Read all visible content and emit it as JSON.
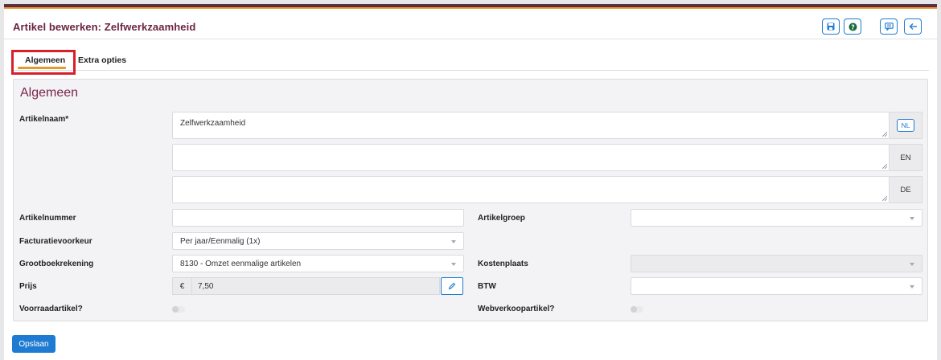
{
  "header": {
    "title": "Artikel bewerken: Zelfwerkzaamheid",
    "buttons": [
      "save-icon",
      "help-icon",
      "comment-icon",
      "back-arrow-icon"
    ]
  },
  "tabs": [
    {
      "label": "Algemeen",
      "active": true
    },
    {
      "label": "Extra opties",
      "active": false
    }
  ],
  "section": {
    "title": "Algemeen"
  },
  "form": {
    "artikelnaam": {
      "label": "Artikelnaam*",
      "translations": [
        {
          "lang": "NL",
          "value": "Zelfwerkzaamheid"
        },
        {
          "lang": "EN",
          "value": ""
        },
        {
          "lang": "DE",
          "value": ""
        }
      ]
    },
    "artikelnummer": {
      "label": "Artikelnummer",
      "value": ""
    },
    "artikelgroep": {
      "label": "Artikelgroep",
      "value": ""
    },
    "facturatievoorkeur": {
      "label": "Facturatievoorkeur",
      "value": "Per jaar/Eenmalig (1x)"
    },
    "grootboekrekening": {
      "label": "Grootboekrekening",
      "value": "8130 - Omzet eenmalige artikelen"
    },
    "kostenplaats": {
      "label": "Kostenplaats",
      "value": "",
      "disabled": true
    },
    "prijs": {
      "label": "Prijs",
      "currency": "€",
      "value": "7,50"
    },
    "btw": {
      "label": "BTW",
      "value": ""
    },
    "voorraadartikel": {
      "label": "Voorraadartikel?",
      "on": false
    },
    "webverkoopartikel": {
      "label": "Webverkoopartikel?",
      "on": false
    }
  },
  "footer": {
    "save_label": "Opslaan"
  },
  "colors": {
    "accent": "#1f7bd1",
    "title": "#6b2340",
    "tab_underline": "#e59a2c",
    "highlight": "#d9202a"
  }
}
